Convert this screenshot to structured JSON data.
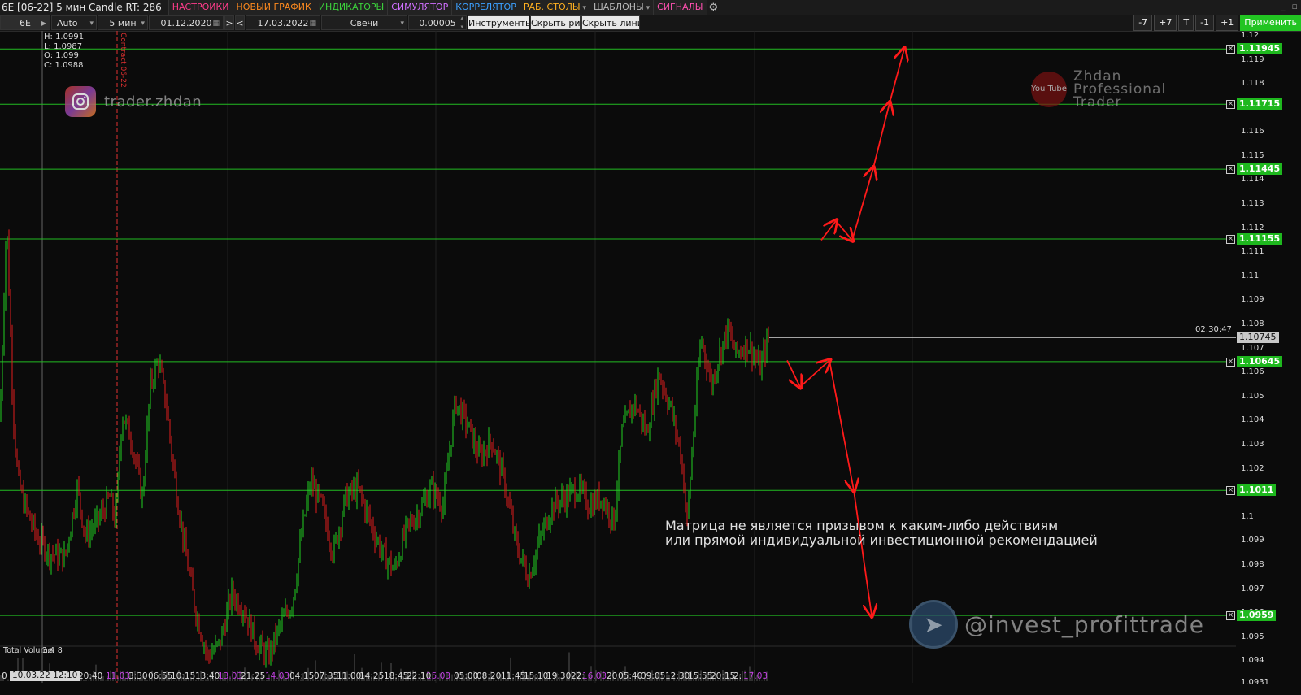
{
  "window": {
    "title": "6E [06-22] 5 мин Candle RT: 286"
  },
  "menu": [
    {
      "label": "НАСТРОЙКИ",
      "color": "#ff3c8a",
      "arrow": false
    },
    {
      "label": "НОВЫЙ ГРАФИК",
      "color": "#ff8a1e",
      "arrow": false
    },
    {
      "label": "ИНДИКАТОРЫ",
      "color": "#3cd23c",
      "arrow": false
    },
    {
      "label": "СИМУЛЯТОР",
      "color": "#d070ff",
      "arrow": false
    },
    {
      "label": "КОРРЕЛЯТОР",
      "color": "#3ca0ff",
      "arrow": false
    },
    {
      "label": "РАБ. СТОЛЫ",
      "color": "#ffb020",
      "arrow": true
    },
    {
      "label": "ШАБЛОНЫ",
      "color": "#bbbbbb",
      "arrow": true
    },
    {
      "label": "СИГНАЛЫ",
      "color": "#ff50b0",
      "arrow": false
    }
  ],
  "toolbar": {
    "symbol": "6E",
    "scale_mode": "Auto",
    "timeframe": "5 мин",
    "date_from": "01.12.2020",
    "nav_next": ">",
    "nav_prev": "<",
    "date_to": "17.03.2022",
    "chart_type": "Свечи",
    "tick_size": "0.00005",
    "tools": "Инструменты",
    "hide_drawings": "Скрыть рис.",
    "hide_lines": "Скрыть линии",
    "btn_minus7": "-7",
    "btn_plus7": "+7",
    "btn_t": "T",
    "btn_minus1": "-1",
    "btn_plus1": "+1",
    "apply": "Применить"
  },
  "ohlc": {
    "high": "H: 1.0991",
    "low": "L: 1.0987",
    "open": "O: 1.099",
    "close": "C: 1.0988"
  },
  "contract_label": "Contract 06-22",
  "watermarks": {
    "instagram": "trader.zhdan",
    "youtube_icon": "You Tube",
    "youtube_lines": [
      "Zhdan",
      "Professional",
      "Trader"
    ],
    "telegram": "@invest_profittrade"
  },
  "disclaimer": {
    "line1": "Матрица не является призывом к каким-либо действиям",
    "line2": "или прямой индивидуальной инвестиционной рекомендацией"
  },
  "timer": "02:30:47",
  "price_axis": {
    "labels": [
      "1.12",
      "1.119",
      "1.118",
      "1.117",
      "1.116",
      "1.115",
      "1.114",
      "1.113",
      "1.112",
      "1.111",
      "1.11",
      "1.109",
      "1.108",
      "1.107",
      "1.106",
      "1.105",
      "1.104",
      "1.103",
      "1.102",
      "1.101",
      "1.1",
      "1.099",
      "1.098",
      "1.097",
      "1.096",
      "1.095",
      "1.094",
      "1.0931"
    ],
    "current_price": "1.10745"
  },
  "levels": [
    "1.11945",
    "1.11715",
    "1.11445",
    "1.11155",
    "1.10645",
    "1.1011",
    "1.0959"
  ],
  "time_axis": {
    "cursor": "10.03.22 12:10",
    "labels": [
      {
        "t": "0",
        "date": false
      },
      {
        "t": "20:40",
        "date": false
      },
      {
        "t": "11.03",
        "date": true
      },
      {
        "t": "3:30",
        "date": false
      },
      {
        "t": "06:55",
        "date": false
      },
      {
        "t": "10:15",
        "date": false
      },
      {
        "t": "13:40",
        "date": false
      },
      {
        "t": "13.03",
        "date": true
      },
      {
        "t": "21:25",
        "date": false
      },
      {
        "t": "14.03",
        "date": true
      },
      {
        "t": "04:15",
        "date": false
      },
      {
        "t": "07:35",
        "date": false
      },
      {
        "t": "11:00",
        "date": false
      },
      {
        "t": "14:25",
        "date": false
      },
      {
        "t": "18:45",
        "date": false
      },
      {
        "t": "22:10",
        "date": false
      },
      {
        "t": "15.03",
        "date": true
      },
      {
        "t": "05:00",
        "date": false
      },
      {
        "t": "08:20",
        "date": false
      },
      {
        "t": "11:45",
        "date": false
      },
      {
        "t": "15:10",
        "date": false
      },
      {
        "t": "19:30",
        "date": false
      },
      {
        "t": "22:",
        "date": false
      },
      {
        "t": "16.03",
        "date": true
      },
      {
        "t": "20",
        "date": false
      },
      {
        "t": "05:40",
        "date": false
      },
      {
        "t": "09:05",
        "date": false
      },
      {
        "t": "12:30",
        "date": false
      },
      {
        "t": "15:55",
        "date": false
      },
      {
        "t": "20:15",
        "date": false
      },
      {
        "t": "2:",
        "date": false
      },
      {
        "t": "17.03",
        "date": true
      }
    ]
  },
  "volume": {
    "label": "Total Volume: 8",
    "value": "3.4"
  },
  "chart_data": {
    "type": "candlestick",
    "ylim": [
      1.0931,
      1.1202
    ],
    "price_path": [
      [
        0,
        1.104
      ],
      [
        8,
        1.1125
      ],
      [
        16,
        1.1045
      ],
      [
        22,
        1.1015
      ],
      [
        30,
        1.1005
      ],
      [
        45,
        1.0992
      ],
      [
        60,
        1.0985
      ],
      [
        80,
        1.0983
      ],
      [
        95,
        1.1012
      ],
      [
        105,
        1.0992
      ],
      [
        120,
        1.0998
      ],
      [
        135,
        1.1008
      ],
      [
        142,
        1.0998
      ],
      [
        150,
        1.1043
      ],
      [
        162,
        1.1032
      ],
      [
        175,
        1.1008
      ],
      [
        185,
        1.1055
      ],
      [
        195,
        1.1065
      ],
      [
        205,
        1.1045
      ],
      [
        215,
        1.1015
      ],
      [
        228,
        1.0985
      ],
      [
        240,
        1.0962
      ],
      [
        255,
        1.0942
      ],
      [
        270,
        1.0947
      ],
      [
        285,
        1.0968
      ],
      [
        300,
        1.0962
      ],
      [
        315,
        1.0948
      ],
      [
        330,
        1.0942
      ],
      [
        345,
        1.0955
      ],
      [
        360,
        1.0965
      ],
      [
        372,
        1.0995
      ],
      [
        382,
        1.1015
      ],
      [
        395,
        1.1005
      ],
      [
        410,
        1.0985
      ],
      [
        425,
        1.1008
      ],
      [
        440,
        1.1012
      ],
      [
        455,
        1.0998
      ],
      [
        470,
        1.0985
      ],
      [
        485,
        1.0978
      ],
      [
        500,
        1.0995
      ],
      [
        515,
        1.1002
      ],
      [
        530,
        1.1012
      ],
      [
        545,
        1.1005
      ],
      [
        560,
        1.1048
      ],
      [
        575,
        1.1038
      ],
      [
        590,
        1.1025
      ],
      [
        605,
        1.1032
      ],
      [
        620,
        1.1015
      ],
      [
        635,
        1.0988
      ],
      [
        650,
        1.0975
      ],
      [
        665,
        1.0992
      ],
      [
        680,
        1.1005
      ],
      [
        695,
        1.1008
      ],
      [
        710,
        1.1012
      ],
      [
        725,
        1.1005
      ],
      [
        740,
        1.1008
      ],
      [
        755,
        1.0998
      ],
      [
        765,
        1.1035
      ],
      [
        780,
        1.1048
      ],
      [
        795,
        1.1035
      ],
      [
        810,
        1.106
      ],
      [
        825,
        1.1045
      ],
      [
        838,
        1.1025
      ],
      [
        845,
        1.0998
      ],
      [
        855,
        1.1045
      ],
      [
        862,
        1.1075
      ],
      [
        875,
        1.1055
      ],
      [
        885,
        1.1068
      ],
      [
        895,
        1.1078
      ],
      [
        905,
        1.1068
      ],
      [
        920,
        1.1072
      ],
      [
        935,
        1.1062
      ],
      [
        945,
        1.1075
      ]
    ],
    "volume_ylim": [
      0,
      10
    ]
  },
  "colors": {
    "background": "#0b0b0b",
    "up_candle": "#22d022",
    "down_candle": "#e01e1e",
    "level_line": "#22bb22",
    "arrow": "#ff1a1a",
    "contract_line": "#e03030",
    "grid": "#222222"
  }
}
